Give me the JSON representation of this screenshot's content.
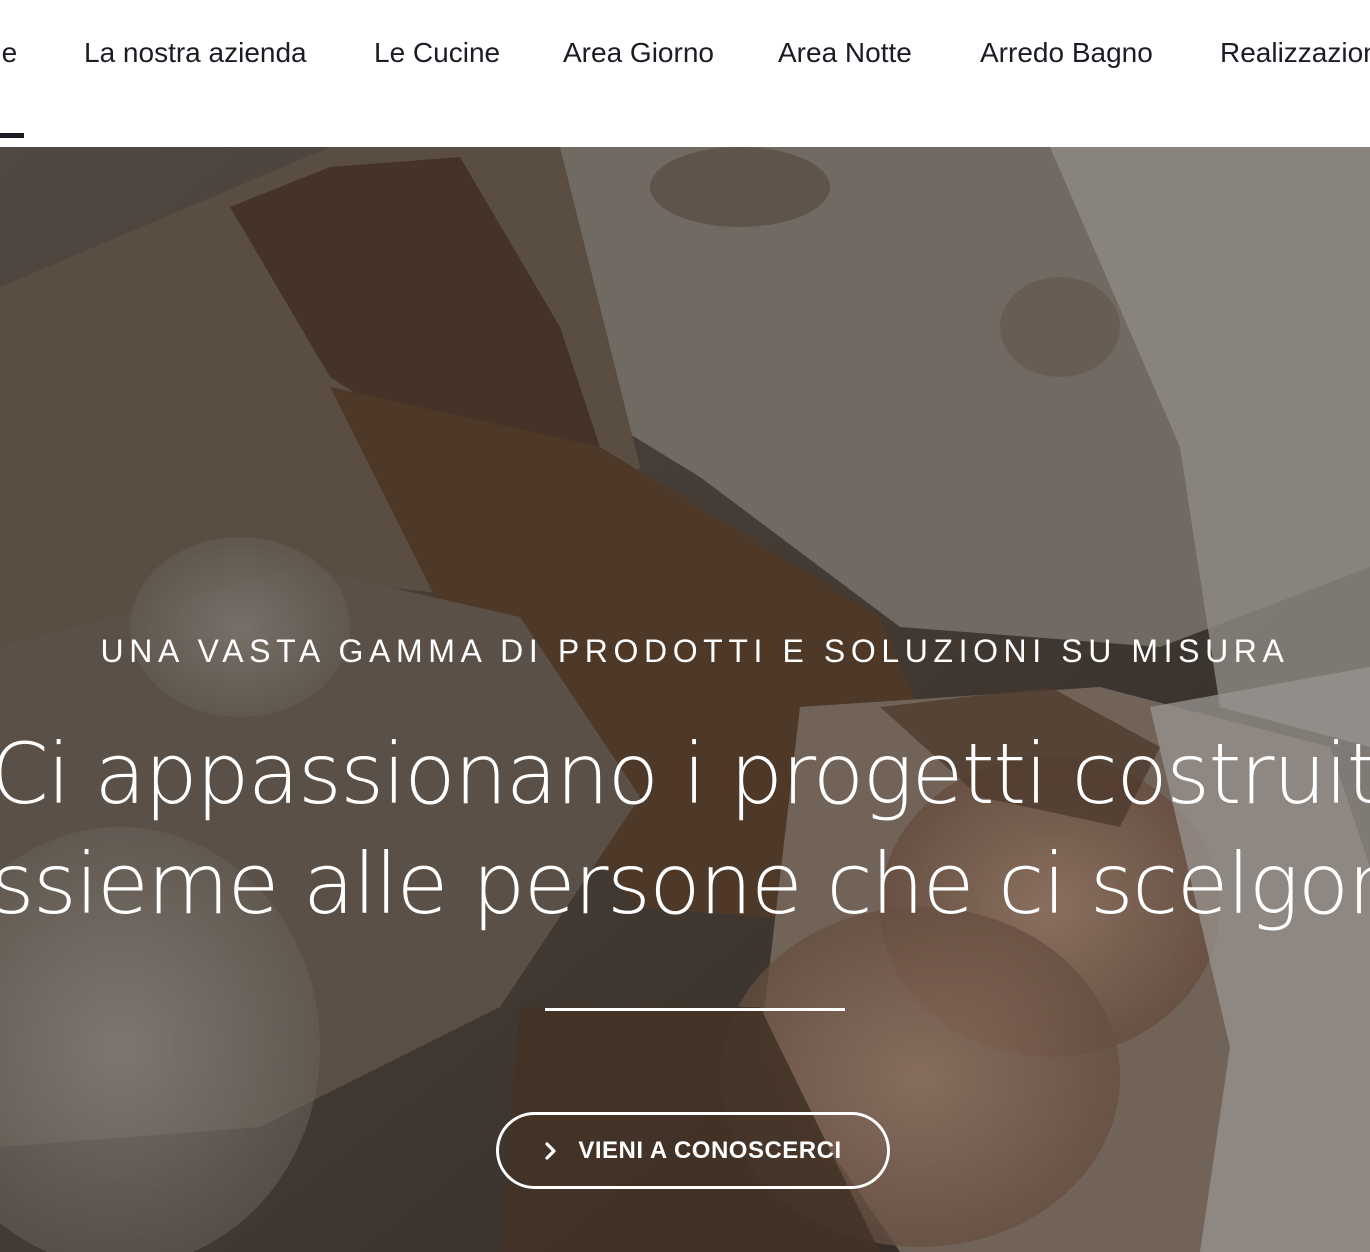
{
  "nav": {
    "items": [
      {
        "label": "ne"
      },
      {
        "label": "La nostra azienda"
      },
      {
        "label": "Le Cucine"
      },
      {
        "label": "Area Giorno"
      },
      {
        "label": "Area Notte"
      },
      {
        "label": "Arredo Bagno"
      },
      {
        "label": "Realizzazioni"
      }
    ],
    "active_index": 0
  },
  "hero": {
    "eyebrow": "UNA VASTA GAMMA DI PRODOTTI E SOLUZIONI SU MISURA",
    "headline_line1": "Ci appassionano i progetti costruiti",
    "headline_line2": "assieme alle persone che ci scelgono",
    "cta_label": "VIENI A CONOSCERCI",
    "cta_icon": "chevron-right-icon"
  },
  "colors": {
    "nav_text": "#1a1d24",
    "hero_text": "#ffffff"
  }
}
